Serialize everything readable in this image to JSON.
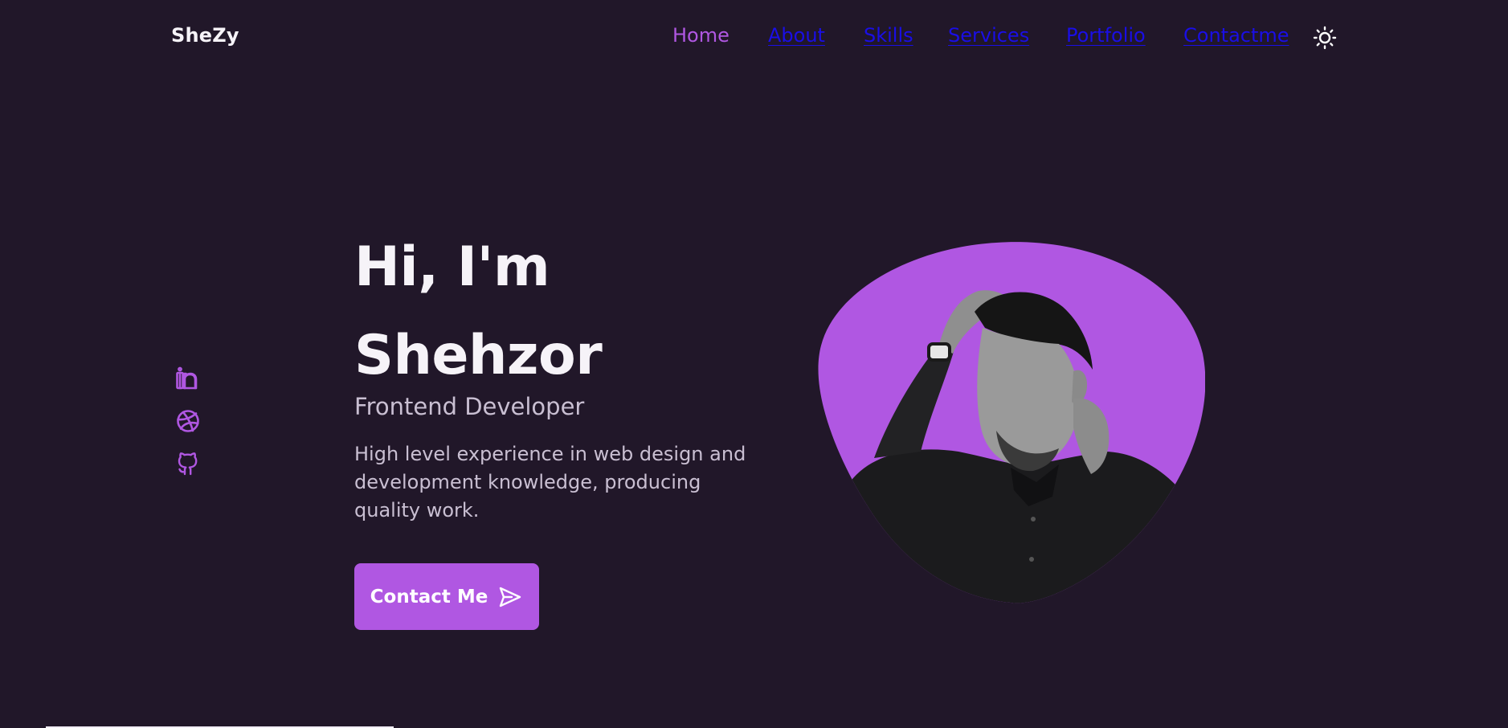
{
  "colors": {
    "background": "#211729",
    "accent": "#b057e2",
    "nav_link": "#1a0ee6",
    "text_light": "#f6f3f8",
    "text_muted": "#c9bfd2"
  },
  "header": {
    "logo": "SheZy",
    "nav": [
      {
        "label": "Home"
      },
      {
        "label": "About"
      },
      {
        "label": "Skills"
      },
      {
        "label": "Services"
      },
      {
        "label": "Portfolio"
      },
      {
        "label": "Contactme"
      }
    ],
    "theme_toggle_icon": "sun-icon"
  },
  "social": [
    {
      "icon": "linkedin-icon"
    },
    {
      "icon": "dribbble-icon"
    },
    {
      "icon": "github-icon"
    }
  ],
  "hero": {
    "title_line1": "Hi, I'm",
    "title_line2": "Shehzor",
    "subtitle": "Frontend Developer",
    "description": "High level experience in web design and development knowledge, producing quality work.",
    "button_label": "Contact Me",
    "button_icon": "send-icon"
  }
}
